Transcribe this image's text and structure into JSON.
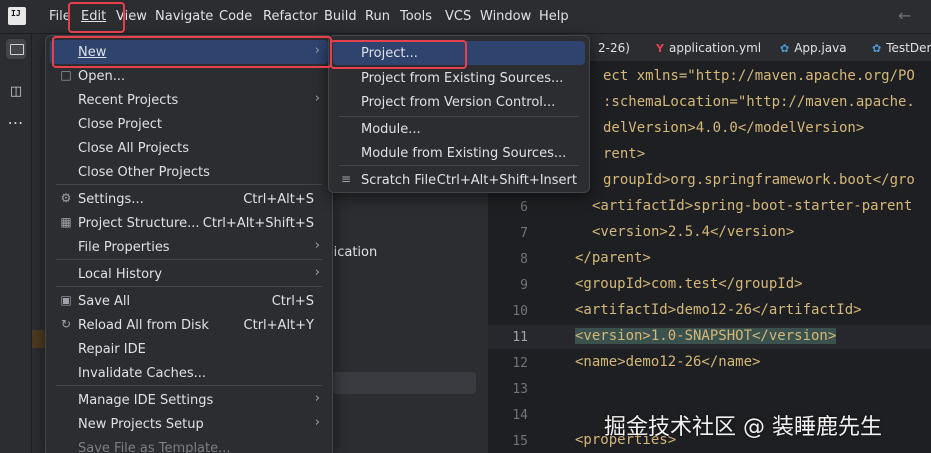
{
  "menubar": {
    "items": [
      "File",
      "Edit",
      "View",
      "Navigate",
      "Code",
      "Refactor",
      "Build",
      "Run",
      "Tools",
      "VCS",
      "Window",
      "Help"
    ],
    "file_label_visible": "File"
  },
  "file_menu": {
    "items": [
      {
        "label": "New",
        "arrow": true,
        "active": true
      },
      {
        "label": "Open...",
        "icon": "folder-icon"
      },
      {
        "label": "Recent Projects",
        "arrow": true
      },
      {
        "label": "Close Project"
      },
      {
        "label": "Close All Projects"
      },
      {
        "label": "Close Other Projects"
      },
      {
        "label": "Settings...",
        "shortcut": "Ctrl+Alt+S",
        "icon": "gear-icon"
      },
      {
        "label": "Project Structure...",
        "shortcut": "Ctrl+Alt+Shift+S",
        "icon": "project-structure-icon"
      },
      {
        "label": "File Properties",
        "arrow": true
      },
      {
        "label": "Local History",
        "arrow": true
      },
      {
        "label": "Save All",
        "shortcut": "Ctrl+S",
        "icon": "save-icon"
      },
      {
        "label": "Reload All from Disk",
        "shortcut": "Ctrl+Alt+Y",
        "icon": "reload-icon"
      },
      {
        "label": "Repair IDE"
      },
      {
        "label": "Invalidate Caches..."
      },
      {
        "label": "Manage IDE Settings",
        "arrow": true
      },
      {
        "label": "New Projects Setup",
        "arrow": true
      },
      {
        "label": "Save File as Template..."
      }
    ]
  },
  "new_submenu": {
    "items": [
      {
        "label": "Project...",
        "active": true
      },
      {
        "label": "Project from Existing Sources..."
      },
      {
        "label": "Project from Version Control..."
      },
      {
        "label": "Module..."
      },
      {
        "label": "Module from Existing Sources..."
      },
      {
        "label": "Scratch File",
        "shortcut": "Ctrl+Alt+Shift+Insert"
      }
    ]
  },
  "project_pane": {
    "partial_text": "lication"
  },
  "editor": {
    "tabs": [
      {
        "label": "2-26)"
      },
      {
        "label": "application.yml",
        "icon_letter": "Y"
      },
      {
        "label": "App.java"
      },
      {
        "label": "TestDem"
      }
    ],
    "lines": [
      {
        "num": "",
        "code": "ect xmlns=\"http://maven.apache.org/PO"
      },
      {
        "num": "",
        "code": ":schemaLocation=\"http://maven.apache."
      },
      {
        "num": "",
        "code": "delVersion>4.0.0</modelVersion>"
      },
      {
        "num": "",
        "code": "rent>"
      },
      {
        "num": "",
        "code": "groupId>org.springframework.boot</gro"
      },
      {
        "num": "6",
        "code": "<artifactId>spring-boot-starter-parent"
      },
      {
        "num": "7",
        "code": "<version>2.5.4</version>"
      },
      {
        "num": "8",
        "code": "</parent>"
      },
      {
        "num": "9",
        "code": "<groupId>com.test</groupId>"
      },
      {
        "num": "10",
        "code": "<artifactId>demo12-26</artifactId>"
      },
      {
        "num": "11",
        "code": "<version>1.0-SNAPSHOT</version>"
      },
      {
        "num": "12",
        "code": "<name>demo12-26</name>"
      },
      {
        "num": "13",
        "code": ""
      },
      {
        "num": "14",
        "code": ""
      },
      {
        "num": "15",
        "code": "<properties>"
      }
    ]
  },
  "watermark": "掘金技术社区 @ 装睡鹿先生",
  "colors": {
    "accent_selection": "#2e436e",
    "annotation_red": "#e5404e",
    "tag_color": "#d5b778",
    "string_color": "#6aab73"
  }
}
